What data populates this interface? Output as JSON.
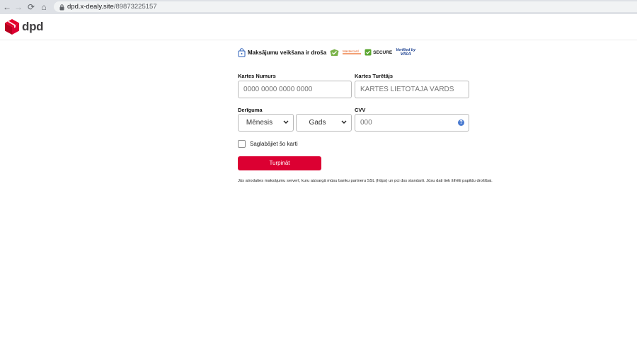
{
  "browser": {
    "url_domain": "dpd.x-dealy.site",
    "url_path": "/89873225157",
    "back_glyph": "←",
    "forward_glyph": "→",
    "reload_glyph": "⟳",
    "home_glyph": "⌂"
  },
  "header": {
    "logo_text": "dpd",
    "logo_color": "#dc0032"
  },
  "form": {
    "secure_title": "Maksājumu veikšana ir droša",
    "badges": {
      "mastercard": "Mastercard",
      "secure": "SECURE",
      "verified": "Verified by",
      "visa": "VISA"
    },
    "card_number": {
      "label": "Kartes Numurs",
      "placeholder": "0000 0000 0000 0000"
    },
    "card_holder": {
      "label": "Kartes Turētājs",
      "placeholder": "KARTES LIETOTĀJA VĀRDS"
    },
    "expiry": {
      "label": "Derīguma",
      "month": "Mēnesis",
      "year": "Gads"
    },
    "cvv": {
      "label": "CVV",
      "placeholder": "000",
      "help_glyph": "?"
    },
    "save_card_label": "Saglabājiet šo karti",
    "submit_label": "Turpināt",
    "submit_color": "#dc0032",
    "note": "Jūs atrodaties maksājumu serverī, kuru aizsargā mūsu banku partneru SSL (https) un pci dss standarti. Jūsu dati tiek šifrēti papildu drošībai."
  }
}
